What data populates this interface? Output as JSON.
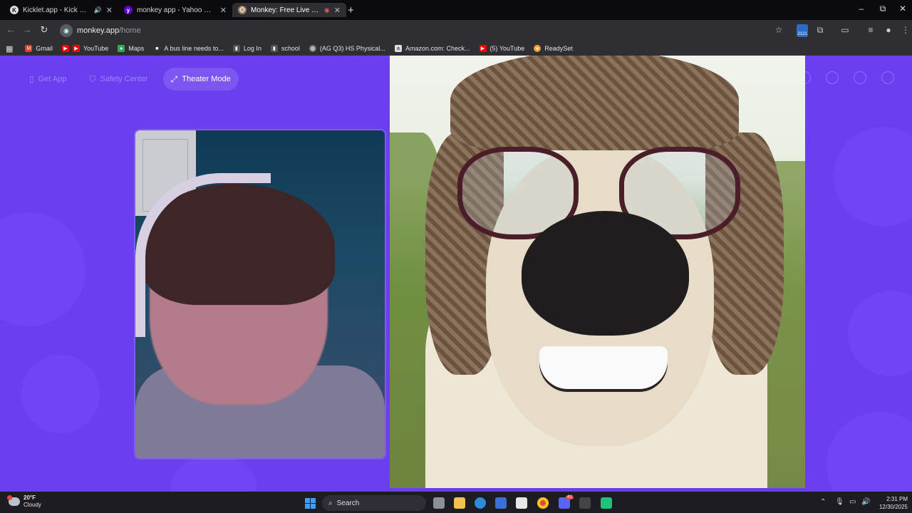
{
  "browser": {
    "tabs": [
      {
        "title": "Kicklet.app - Kick Chatbot & ...",
        "favicon": "kicklet-icon",
        "audio": true
      },
      {
        "title": "monkey app - Yahoo Search Re...",
        "favicon": "yahoo-icon"
      },
      {
        "title": "Monkey: Free Live Video Ch...",
        "favicon": "monkey-icon",
        "recording": true,
        "active": true
      }
    ],
    "new_tab": "+",
    "window_controls": {
      "minimize": "–",
      "maximize": "⧉",
      "close": "✕"
    },
    "nav": {
      "back": "←",
      "forward": "→",
      "reload": "↻"
    },
    "url": {
      "host": "monkey.app",
      "path": "/home"
    },
    "extension_badge": "2121",
    "bookmarks": [
      {
        "label": "Gmail",
        "color": "#e33b2e"
      },
      {
        "label": "",
        "color": "#ff0000",
        "icon": "youtube-icon"
      },
      {
        "label": "YouTube",
        "color": "#ff0000"
      },
      {
        "label": "Maps",
        "color": "#34a853"
      },
      {
        "label": "A bus line needs to...",
        "color": "#333333"
      },
      {
        "label": "Log In",
        "color": "#555555"
      },
      {
        "label": "school",
        "color": "#555555"
      },
      {
        "label": "(AG Q3) HS Physical...",
        "color": "#777777"
      },
      {
        "label": "Amazon.com: Check...",
        "color": "#dddddd"
      },
      {
        "label": "(5) YouTube",
        "color": "#ff0000"
      },
      {
        "label": "ReadySet",
        "color": "#f2a33a"
      }
    ]
  },
  "app": {
    "nav": {
      "get_app": "Get App",
      "safety_center": "Safety Center",
      "theater_mode": "Theater Mode"
    },
    "accent": "#6a3ff0"
  },
  "taskbar": {
    "weather": {
      "temp": "20°F",
      "condition": "Cloudy"
    },
    "search_label": "Search",
    "time": "2:31 PM",
    "date": "12/30/2025",
    "discord_badge": "41"
  }
}
